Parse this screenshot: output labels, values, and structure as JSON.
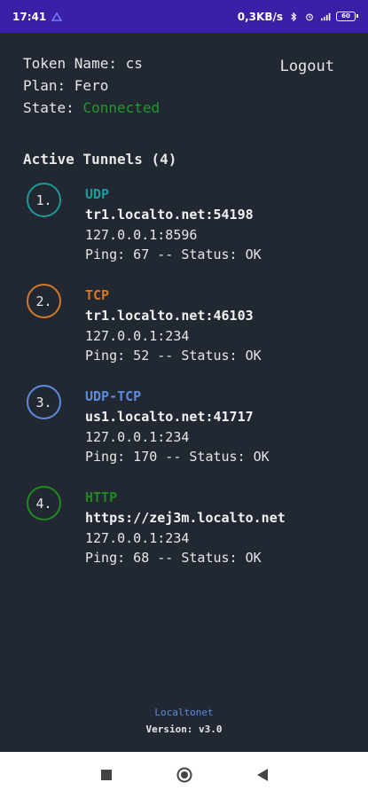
{
  "status_bar": {
    "time": "17:41",
    "net_speed": "0,3KB/s",
    "battery": "60"
  },
  "account": {
    "token_label": "Token Name: ",
    "token_value": "cs",
    "plan_label": "Plan: ",
    "plan_value": "Fero",
    "state_label": "State: ",
    "state_value": "Connected"
  },
  "logout_label": "Logout",
  "tunnels_title": "Active Tunnels (4)",
  "tunnels": [
    {
      "index": "1.",
      "protocol": "UDP",
      "address": "tr1.localto.net:54198",
      "local": "127.0.0.1:8596",
      "ping": "Ping: 67 -- Status: OK",
      "color": "#1a9a9a"
    },
    {
      "index": "2.",
      "protocol": "TCP",
      "address": "tr1.localto.net:46103",
      "local": "127.0.0.1:234",
      "ping": "Ping: 52 -- Status: OK",
      "color": "#d2782c"
    },
    {
      "index": "3.",
      "protocol": "UDP-TCP",
      "address": "us1.localto.net:41717",
      "local": "127.0.0.1:234",
      "ping": "Ping: 170 -- Status: OK",
      "color": "#5b8be0"
    },
    {
      "index": "4.",
      "protocol": "HTTP",
      "address": "https://zej3m.localto.net",
      "local": "127.0.0.1:234",
      "ping": "Ping: 68 -- Status: OK",
      "color": "#1f8a1f"
    }
  ],
  "footer": {
    "brand": "Localtonet",
    "version": "Version: v3.0"
  }
}
